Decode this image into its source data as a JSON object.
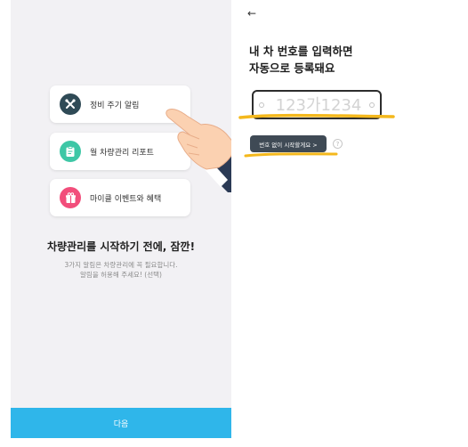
{
  "left_screen": {
    "cards": [
      {
        "label": "정비 주기 알림",
        "icon": "wrench-screwdriver-icon"
      },
      {
        "label": "월 차량관리 리포트",
        "icon": "clipboard-report-icon"
      },
      {
        "label": "마이클 이벤트와 혜택",
        "icon": "gift-icon"
      }
    ],
    "headline": "차량관리를 시작하기 전에, 잠깐!",
    "desc_line1": "3가지 알림은 차량관리에 꼭 필요합니다.",
    "desc_line2": "알림을 허용해 주세요! (선택)",
    "next_label": "다음"
  },
  "right_screen": {
    "back_icon": "←",
    "title_line1": "내 차 번호를 입력하면",
    "title_line2": "자동으로 등록돼요",
    "plate_placeholder": "123가1234",
    "no_number_label": "번호 없이 시작할게요 >",
    "help_icon": "?"
  },
  "colors": {
    "next_button": "#2fb6ea",
    "highlight": "#f4b81c",
    "dark_button": "#3f4a55",
    "icon_wrench_bg": "#2f4a56",
    "icon_report_bg": "#3ec7a6",
    "icon_gift_bg": "#f24e7b"
  }
}
